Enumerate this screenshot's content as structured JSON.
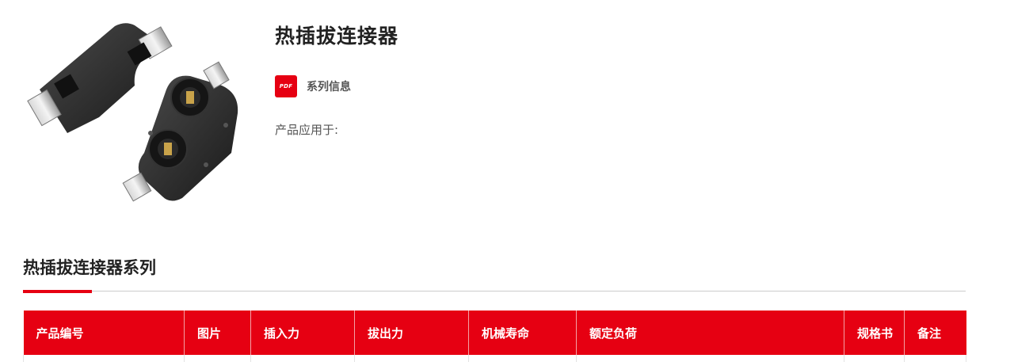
{
  "product": {
    "title": "热插拔连接器",
    "series_link": "系列信息",
    "pdf_icon_text": "PDF",
    "applied_label": "产品应用于:"
  },
  "section": {
    "title": "热插拔连接器系列"
  },
  "table": {
    "headers": [
      "产品编号",
      "图片",
      "插入力",
      "拔出力",
      "机械寿命",
      "额定负荷",
      "规格书",
      "备注"
    ]
  },
  "colors": {
    "accent": "#e60012"
  }
}
